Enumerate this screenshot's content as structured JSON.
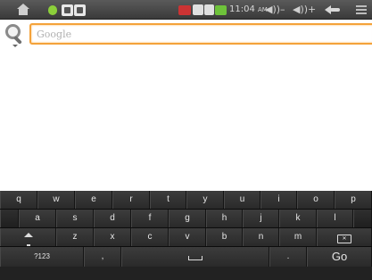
{
  "status_bar": {
    "time": "11:04",
    "ampm": "AM",
    "volume_down_label": "◀))–",
    "volume_up_label": "◀))+"
  },
  "search": {
    "value": "",
    "placeholder": "Google",
    "accent_color": "#f4a23a"
  },
  "keyboard": {
    "row1": [
      "q",
      "w",
      "e",
      "r",
      "t",
      "y",
      "u",
      "i",
      "o",
      "p"
    ],
    "row2": [
      "a",
      "s",
      "d",
      "f",
      "g",
      "h",
      "j",
      "k",
      "l"
    ],
    "row3": [
      "z",
      "x",
      "c",
      "v",
      "b",
      "n",
      "m"
    ],
    "symbols_label": "?123",
    "comma_label": ",",
    "period_label": ".",
    "go_label": "Go"
  }
}
